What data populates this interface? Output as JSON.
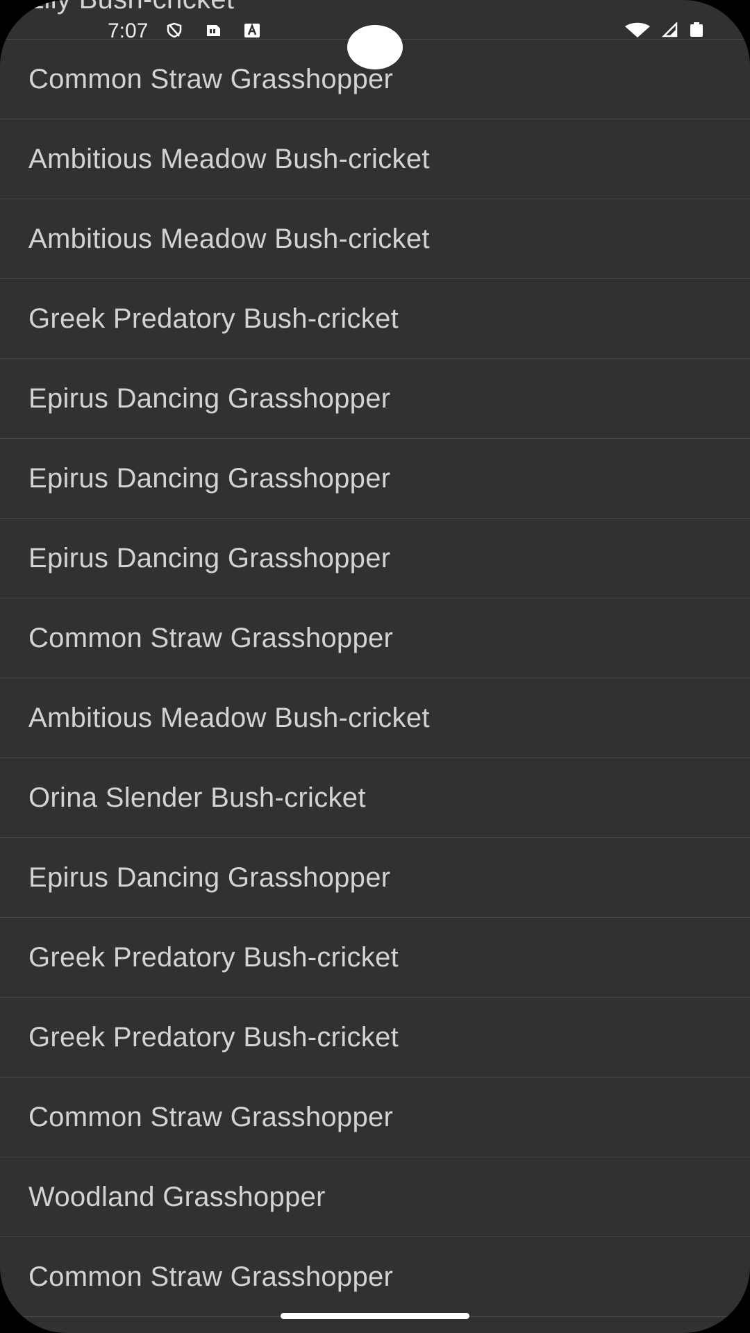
{
  "status_bar": {
    "time": "7:07",
    "left_icons": [
      "vpn-shield-icon",
      "sim-card-icon",
      "text-a-icon"
    ],
    "right_icons": [
      "wifi-icon",
      "signal-icon",
      "battery-icon"
    ]
  },
  "list": {
    "items": [
      "Lily Bush-cricket",
      "Common Straw Grasshopper",
      "Ambitious Meadow Bush-cricket",
      "Ambitious Meadow Bush-cricket",
      "Greek Predatory Bush-cricket",
      "Epirus Dancing Grasshopper",
      "Epirus Dancing Grasshopper",
      "Epirus Dancing Grasshopper",
      "Common Straw Grasshopper",
      "Ambitious Meadow Bush-cricket",
      "Orina Slender Bush-cricket",
      "Epirus Dancing Grasshopper",
      "Greek Predatory Bush-cricket",
      "Greek Predatory Bush-cricket",
      "Common Straw Grasshopper",
      "Woodland Grasshopper",
      "Common Straw Grasshopper"
    ]
  },
  "colors": {
    "background": "#313131",
    "divider": "#4a4a4a",
    "text": "#d3d3d3"
  }
}
